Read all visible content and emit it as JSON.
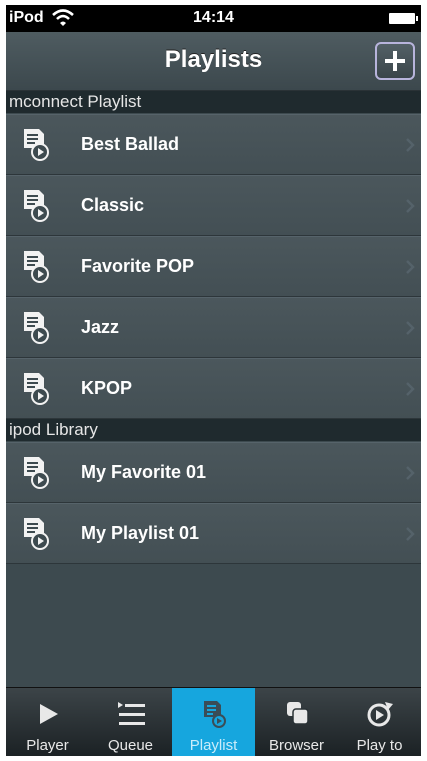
{
  "status_bar": {
    "carrier": "iPod",
    "time": "14:14"
  },
  "nav": {
    "title": "Playlists"
  },
  "sections": [
    {
      "header": "mconnect Playlist",
      "items": [
        "Best Ballad",
        "Classic",
        "Favorite POP",
        "Jazz",
        "KPOP"
      ]
    },
    {
      "header": "ipod Library",
      "items": [
        "My Favorite 01",
        "My Playlist 01"
      ]
    }
  ],
  "tabs": [
    {
      "label": "Player",
      "icon": "play-icon"
    },
    {
      "label": "Queue",
      "icon": "queue-icon"
    },
    {
      "label": "Playlist",
      "icon": "playlist-icon",
      "active": true
    },
    {
      "label": "Browser",
      "icon": "browser-icon"
    },
    {
      "label": "Play to",
      "icon": "play-to-icon"
    }
  ],
  "colors": {
    "background": "#3d4a4f",
    "active_tab": "#16a6de",
    "section_header": "#1f2a2e"
  }
}
